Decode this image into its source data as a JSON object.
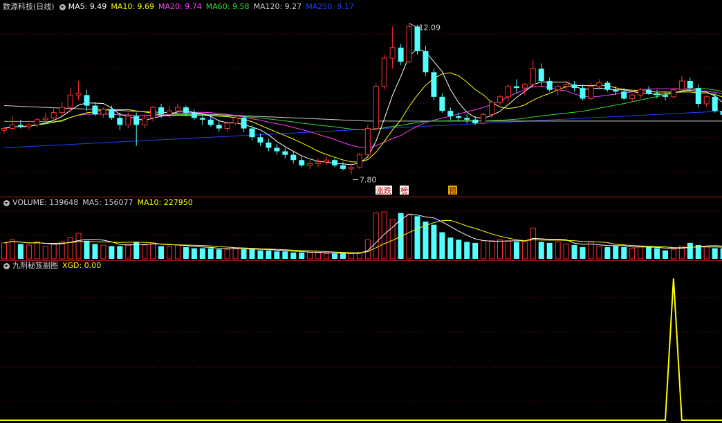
{
  "main": {
    "title": "数源科技(日线)",
    "legend": [
      {
        "text": "MA5: 9.49",
        "color": "#ffffff"
      },
      {
        "text": "MA10: 9.69",
        "color": "#ffff00"
      },
      {
        "text": "MA20: 9.74",
        "color": "#ff40ff"
      },
      {
        "text": "MA60: 9.58",
        "color": "#30e030"
      },
      {
        "text": "MA120: 9.27",
        "color": "#d0d0d0"
      },
      {
        "text": "MA250: 9.17",
        "color": "#2040ff"
      }
    ],
    "high_label": "12.09",
    "low_label": "7.80",
    "tags": [
      {
        "text": "涨跌",
        "bg": "#ffffff",
        "color": "#c00000"
      },
      {
        "text": "榜",
        "bg": "#ffffff",
        "color": "#c00000"
      },
      {
        "text": "预",
        "bg": "#d8b000",
        "color": "#800000"
      }
    ]
  },
  "volume": {
    "legend": [
      {
        "text": "VOLUME: 139648",
        "color": "#d0d0d0"
      },
      {
        "text": "MA5: 156077",
        "color": "#d0d0d0"
      },
      {
        "text": "MA10: 227950",
        "color": "#ffff00"
      }
    ]
  },
  "indicator": {
    "legend": [
      {
        "text": "九阴秘笈副图",
        "color": "#d0d0d0"
      },
      {
        "text": "XGD: 0.00",
        "color": "#ffff00"
      }
    ]
  },
  "chart_data": {
    "type": "candlestick",
    "price_range": [
      7.2,
      12.4
    ],
    "candles": [
      [
        9.05,
        9.15,
        8.95,
        9.1
      ],
      [
        9.1,
        9.45,
        9.05,
        9.2
      ],
      [
        9.2,
        9.35,
        9.1,
        9.15
      ],
      [
        9.15,
        9.25,
        9.05,
        9.2
      ],
      [
        9.2,
        9.4,
        9.15,
        9.35
      ],
      [
        9.35,
        9.55,
        9.25,
        9.4
      ],
      [
        9.4,
        9.7,
        9.3,
        9.55
      ],
      [
        9.55,
        9.85,
        9.45,
        9.7
      ],
      [
        9.7,
        10.25,
        9.6,
        10.05
      ],
      [
        10.05,
        10.45,
        9.9,
        10.1
      ],
      [
        10.05,
        10.2,
        9.6,
        9.75
      ],
      [
        9.75,
        9.85,
        9.45,
        9.5
      ],
      [
        9.5,
        9.7,
        9.4,
        9.65
      ],
      [
        9.65,
        9.75,
        9.35,
        9.4
      ],
      [
        9.4,
        9.55,
        9.05,
        9.2
      ],
      [
        9.2,
        9.55,
        9.1,
        9.45
      ],
      [
        9.45,
        9.55,
        8.6,
        9.2
      ],
      [
        9.2,
        9.5,
        9.1,
        9.4
      ],
      [
        9.4,
        9.75,
        9.3,
        9.7
      ],
      [
        9.7,
        9.8,
        9.4,
        9.5
      ],
      [
        9.5,
        9.75,
        9.4,
        9.6
      ],
      [
        9.6,
        9.8,
        9.5,
        9.7
      ],
      [
        9.7,
        9.75,
        9.45,
        9.55
      ],
      [
        9.55,
        9.65,
        9.35,
        9.4
      ],
      [
        9.4,
        9.5,
        9.2,
        9.35
      ],
      [
        9.35,
        9.45,
        9.15,
        9.2
      ],
      [
        9.2,
        9.35,
        9.0,
        9.1
      ],
      [
        9.1,
        9.3,
        9.0,
        9.25
      ],
      [
        9.25,
        9.45,
        9.2,
        9.4
      ],
      [
        9.4,
        9.45,
        9.0,
        9.1
      ],
      [
        9.1,
        9.2,
        8.75,
        8.85
      ],
      [
        8.85,
        8.95,
        8.6,
        8.7
      ],
      [
        8.7,
        8.8,
        8.45,
        8.55
      ],
      [
        8.55,
        8.65,
        8.35,
        8.45
      ],
      [
        8.45,
        8.55,
        8.25,
        8.35
      ],
      [
        8.35,
        8.45,
        8.1,
        8.2
      ],
      [
        8.2,
        8.3,
        8.0,
        8.05
      ],
      [
        8.05,
        8.2,
        7.95,
        8.1
      ],
      [
        8.1,
        8.25,
        8.0,
        8.15
      ],
      [
        8.15,
        8.3,
        8.05,
        8.2
      ],
      [
        8.2,
        8.25,
        8.0,
        8.05
      ],
      [
        8.05,
        8.15,
        7.9,
        7.95
      ],
      [
        7.95,
        8.1,
        7.8,
        8.0
      ],
      [
        8.0,
        8.4,
        7.95,
        8.35
      ],
      [
        8.35,
        9.2,
        8.3,
        9.1
      ],
      [
        9.1,
        10.4,
        9.05,
        10.3
      ],
      [
        10.3,
        11.2,
        10.2,
        11.1
      ],
      [
        11.1,
        12.0,
        10.8,
        11.4
      ],
      [
        11.4,
        11.5,
        10.9,
        11.0
      ],
      [
        11.0,
        12.09,
        10.95,
        12.0
      ],
      [
        12.0,
        12.05,
        11.2,
        11.3
      ],
      [
        11.3,
        11.45,
        10.6,
        10.7
      ],
      [
        10.7,
        10.8,
        9.9,
        10.0
      ],
      [
        10.0,
        10.1,
        9.55,
        9.6
      ],
      [
        9.6,
        9.7,
        9.35,
        9.45
      ],
      [
        9.45,
        9.55,
        9.3,
        9.4
      ],
      [
        9.4,
        9.5,
        9.25,
        9.35
      ],
      [
        9.35,
        9.45,
        9.2,
        9.25
      ],
      [
        9.25,
        9.55,
        9.2,
        9.5
      ],
      [
        9.5,
        9.9,
        9.4,
        9.85
      ],
      [
        9.85,
        10.05,
        9.75,
        10.0
      ],
      [
        10.0,
        10.35,
        9.85,
        10.3
      ],
      [
        10.3,
        10.5,
        10.1,
        10.25
      ],
      [
        10.25,
        10.4,
        10.05,
        10.35
      ],
      [
        10.35,
        11.05,
        10.25,
        10.8
      ],
      [
        10.8,
        10.95,
        10.3,
        10.45
      ],
      [
        10.45,
        10.55,
        10.15,
        10.2
      ],
      [
        10.2,
        10.35,
        10.05,
        10.3
      ],
      [
        10.3,
        10.45,
        10.15,
        10.35
      ],
      [
        10.35,
        10.45,
        10.15,
        10.25
      ],
      [
        10.25,
        10.35,
        9.9,
        9.95
      ],
      [
        9.95,
        10.4,
        9.9,
        10.3
      ],
      [
        10.3,
        10.5,
        10.2,
        10.4
      ],
      [
        10.4,
        10.45,
        10.15,
        10.2
      ],
      [
        10.2,
        10.3,
        10.05,
        10.15
      ],
      [
        10.15,
        10.25,
        9.9,
        9.95
      ],
      [
        9.95,
        10.1,
        9.85,
        10.05
      ],
      [
        10.05,
        10.25,
        9.95,
        10.2
      ],
      [
        10.2,
        10.3,
        10.05,
        10.1
      ],
      [
        10.1,
        10.2,
        9.95,
        10.05
      ],
      [
        10.05,
        10.15,
        9.9,
        10.0
      ],
      [
        10.0,
        10.25,
        9.95,
        10.2
      ],
      [
        10.2,
        10.6,
        10.15,
        10.45
      ],
      [
        10.45,
        10.55,
        10.2,
        10.25
      ],
      [
        10.25,
        10.35,
        9.7,
        9.8
      ],
      [
        9.8,
        10.05,
        9.7,
        10.0
      ],
      [
        10.0,
        10.1,
        9.55,
        9.6
      ],
      [
        9.6,
        9.7,
        9.4,
        9.49
      ]
    ],
    "volumes": [
      0.15,
      0.18,
      0.14,
      0.13,
      0.16,
      0.12,
      0.14,
      0.16,
      0.2,
      0.24,
      0.17,
      0.14,
      0.13,
      0.12,
      0.12,
      0.14,
      0.16,
      0.13,
      0.15,
      0.12,
      0.12,
      0.13,
      0.11,
      0.1,
      0.1,
      0.1,
      0.09,
      0.09,
      0.1,
      0.09,
      0.09,
      0.08,
      0.08,
      0.07,
      0.07,
      0.06,
      0.06,
      0.06,
      0.06,
      0.05,
      0.05,
      0.05,
      0.05,
      0.06,
      0.18,
      0.43,
      0.44,
      0.37,
      0.43,
      0.42,
      0.4,
      0.35,
      0.32,
      0.25,
      0.2,
      0.18,
      0.16,
      0.15,
      0.17,
      0.17,
      0.18,
      0.17,
      0.16,
      0.16,
      0.29,
      0.16,
      0.15,
      0.16,
      0.14,
      0.13,
      0.11,
      0.16,
      0.12,
      0.11,
      0.12,
      0.11,
      0.1,
      0.12,
      0.11,
      0.1,
      0.08,
      0.09,
      0.12,
      0.15,
      0.13,
      0.12,
      0.1,
      0.1
    ],
    "volume_range": [
      0,
      0.48
    ],
    "xgd": [
      0,
      0,
      0,
      0,
      0,
      0,
      0,
      0,
      0,
      0,
      0,
      0,
      0,
      0,
      0,
      0,
      0,
      0,
      0,
      0,
      0,
      0,
      0,
      0,
      0,
      0,
      0,
      0,
      0,
      0,
      0,
      0,
      0,
      0,
      0,
      0,
      0,
      0,
      0,
      0,
      0,
      0,
      0,
      0,
      0,
      0,
      0,
      0,
      0,
      0,
      0,
      0,
      0,
      0,
      0,
      0,
      0,
      0,
      0,
      0,
      0,
      0,
      0,
      0,
      0,
      0,
      0,
      0,
      0,
      0,
      0,
      0,
      0,
      0,
      0,
      0,
      0,
      0,
      0,
      0,
      0,
      1,
      0,
      0,
      0,
      0,
      0,
      0
    ],
    "xgd_range": [
      0,
      1.05
    ]
  }
}
